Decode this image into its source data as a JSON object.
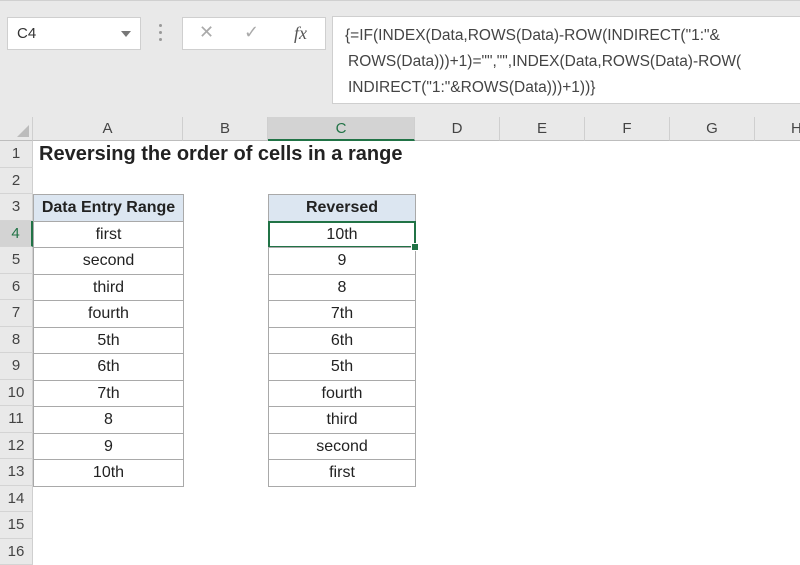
{
  "name_box": {
    "value": "C4",
    "dropdown_icon": "chevron-down-icon"
  },
  "formula_bar": {
    "cancel_icon": "close-icon",
    "enter_icon": "check-icon",
    "function_label": "fx",
    "formula_lines": [
      "{=IF(INDEX(Data,ROWS(Data)-ROW(INDIRECT(\"1:\"&",
      "ROWS(Data)))+1)=\"\",\"\",INDEX(Data,ROWS(Data)-ROW(",
      "INDIRECT(\"1:\"&ROWS(Data)))+1))}"
    ]
  },
  "columns": [
    "A",
    "B",
    "C",
    "D",
    "E",
    "F",
    "G",
    "H"
  ],
  "selected_column": "C",
  "rows": [
    "1",
    "2",
    "3",
    "4",
    "5",
    "6",
    "7",
    "8",
    "9",
    "10",
    "11",
    "12",
    "13",
    "14",
    "15",
    "16"
  ],
  "selected_row": "4",
  "colors": {
    "accent_green": "#217346",
    "header_fill": "#dce6f1"
  },
  "sheet": {
    "title": "Reversing the order of cells in a range",
    "data_header": "Data Entry Range",
    "reversed_header": "Reversed",
    "data_values": [
      "first",
      "second",
      "third",
      "fourth",
      "5th",
      "6th",
      "7th",
      "8",
      "9",
      "10th"
    ],
    "reversed_values": [
      "10th",
      "9",
      "8",
      "7th",
      "6th",
      "5th",
      "fourth",
      "third",
      "second",
      "first"
    ],
    "active_cell": "C4"
  }
}
